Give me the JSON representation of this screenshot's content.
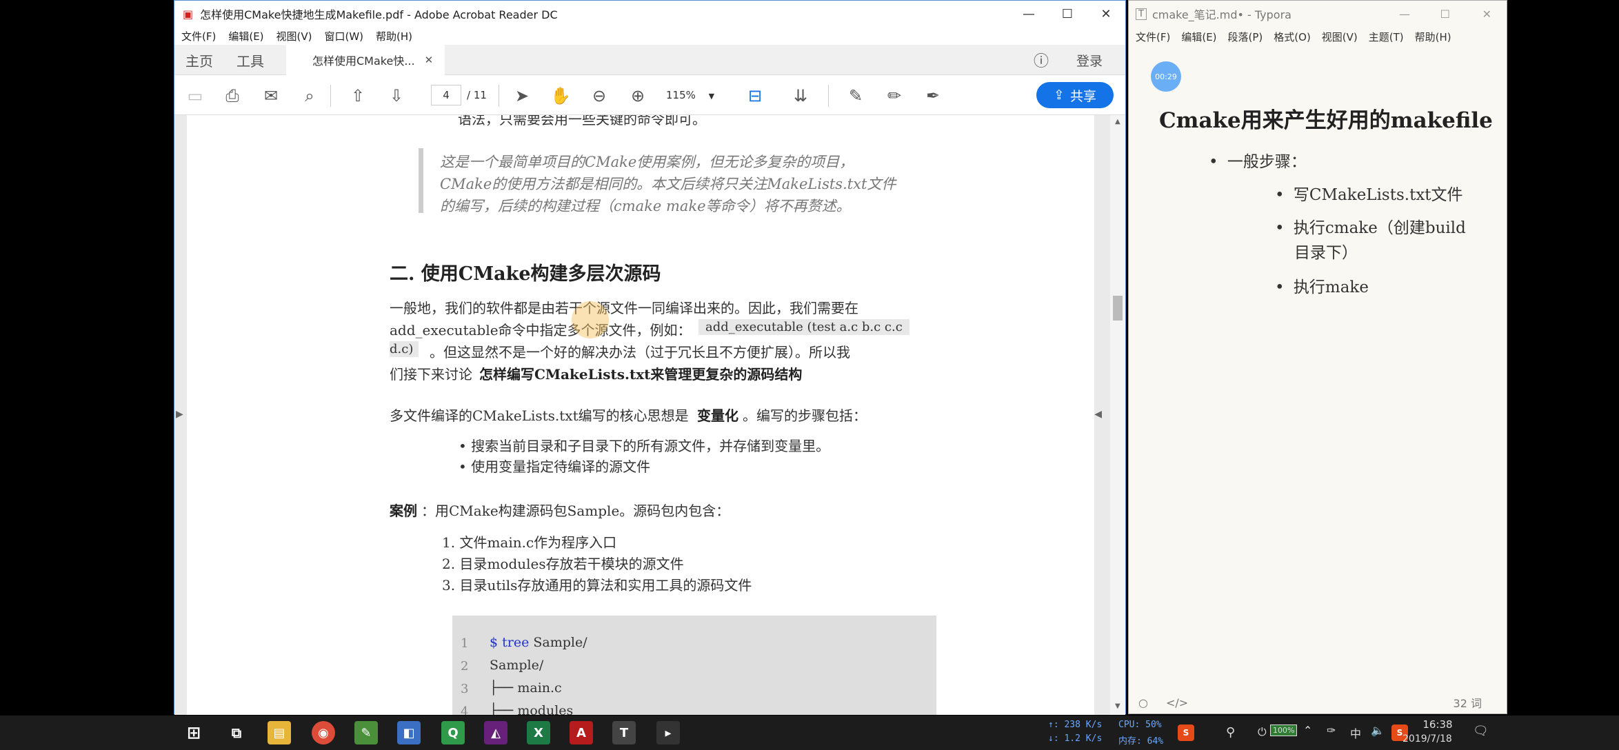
{
  "acrobat": {
    "title": "怎样使用CMake快捷地生成Makefile.pdf - Adobe Acrobat Reader DC",
    "menu": [
      "文件(F)",
      "编辑(E)",
      "视图(V)",
      "窗口(W)",
      "帮助(H)"
    ],
    "nav_home": "主页",
    "nav_tools": "工具",
    "doc_tab": "怎样使用CMake快...",
    "login": "登录",
    "page_current": "4",
    "page_total": "/ 11",
    "zoom": "115%",
    "share": "共享",
    "content": {
      "top_fragment": "语法，只需要会用一些关键的命令即可。",
      "quote": [
        "这是一个最简单项目的CMake使用案例，但无论多复杂的项目，",
        "CMake的使用方法都是相同的。本文后续将只关注MakeLists.txt文件",
        "的编写，后续的构建过程（cmake make等命令）将不再赘述。"
      ],
      "heading": "二. 使用CMake构建多层次源码",
      "p1_line1": "一般地，我们的软件都是由若干个源文件一同编译出来的。因此，我们需要在",
      "p1_line2a": "add_executable命令中指定多个源文件，例如：",
      "p1_code1": "add_executable (test a.c b.c c.c",
      "p1_code2": "d.c)",
      "p1_line3": "。但这显然不是一个好的解决办法（过于冗长且不方便扩展）。所以我",
      "p1_line4a": "们接下来讨论",
      "p1_line4b": "怎样编写CMakeLists.txt来管理更复杂的源码结构",
      "p2a": "多文件编译的CMakeLists.txt编写的核心思想是",
      "p2b": "变量化",
      "p2c": "。编写的步骤包括：",
      "bullets": [
        "搜索当前目录和子目录下的所有源文件，并存储到变量里。",
        "使用变量指定待编译的源文件"
      ],
      "case_label": "案例",
      "case_text": "：用CMake构建源码包Sample。源码包内包含：",
      "ordered": [
        "文件main.c作为程序入口",
        "目录modules存放若干模块的源文件",
        "目录utils存放通用的算法和实用工具的源码文件"
      ],
      "code_lines": [
        {
          "n": "1",
          "prompt": "$ tree",
          "text": " Sample/"
        },
        {
          "n": "2",
          "prompt": "",
          "text": "Sample/"
        },
        {
          "n": "3",
          "prompt": "",
          "text": "├── main.c"
        },
        {
          "n": "4",
          "prompt": "",
          "text": "├── modules"
        }
      ]
    }
  },
  "typora": {
    "title": "cmake_笔记.md• - Typora",
    "menu": [
      "文件(F)",
      "编辑(E)",
      "段落(P)",
      "格式(O)",
      "视图(V)",
      "主题(T)",
      "帮助(H)"
    ],
    "timer": "00:29",
    "heading": "Cmake用来产生好用的makefile",
    "bullet1": "一般步骤：",
    "sub_bullets": [
      "写CMakeLists.txt文件",
      "执行cmake（创建build",
      "目录下）",
      "执行make"
    ],
    "word_count": "32 词"
  },
  "taskbar": {
    "net_up": "↑: 238 K/s",
    "net_down": "↓: 1.2 K/s",
    "cpu": "CPU: 50%",
    "mem": "内存: 64%",
    "battery": "100%",
    "ime": "中",
    "time": "16:38",
    "date": "2019/7/18"
  },
  "colors": {
    "accent": "#1473e6",
    "taskbar": "#1c1c1c"
  }
}
